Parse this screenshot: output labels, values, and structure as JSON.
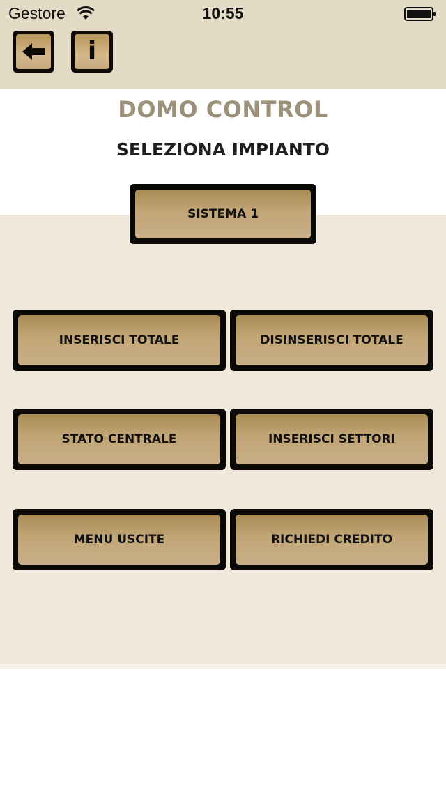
{
  "status_bar": {
    "carrier": "Gestore",
    "time": "10:55"
  },
  "toolbar": {
    "back_icon": "arrow-left-icon",
    "info_icon": "info-icon",
    "info_glyph": "i"
  },
  "header": {
    "app_title": "DOMO CONTROL",
    "subtitle": "SELEZIONA IMPIANTO"
  },
  "system_selector": {
    "label": "SISTEMA 1"
  },
  "actions": {
    "arm_all": "INSERISCI TOTALE",
    "disarm_all": "DISINSERISCI TOTALE",
    "panel_status": "STATO CENTRALE",
    "arm_sectors": "INSERISCI SETTORI",
    "outputs_menu": "MENU USCITE",
    "request_credit": "RICHIEDI CREDITO"
  },
  "colors": {
    "top_bar": "#e3dbc5",
    "panel": "#efe8db",
    "button_frame": "#0b0906",
    "button_face": "#c2a677",
    "title": "#9c927c"
  }
}
